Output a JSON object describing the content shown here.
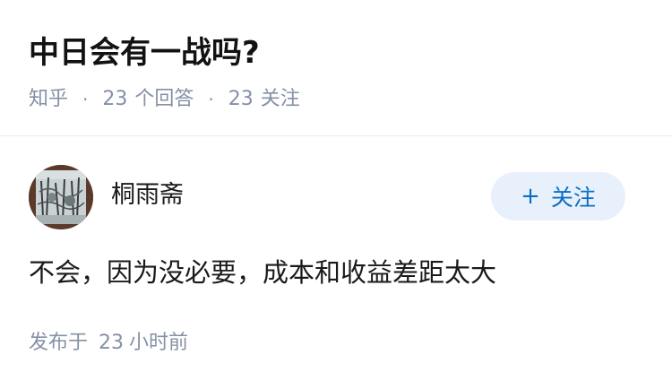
{
  "question": {
    "title": "中日会有一战吗?",
    "source": "知乎",
    "separator": "·",
    "answer_count": "23",
    "answer_label": "个回答",
    "follower_count": "23",
    "follower_label": "关注"
  },
  "answer": {
    "author_name": "桐雨斋",
    "follow_plus": "+",
    "follow_label": "关注",
    "content": "不会，因为没必要，成本和收益差距太大",
    "time_prefix": "发布于",
    "time_value": "23",
    "time_unit": "小时前"
  },
  "colors": {
    "meta_gray": "#8590a6",
    "follow_blue": "#0b6ec4",
    "follow_bg": "#e8f1fb"
  }
}
